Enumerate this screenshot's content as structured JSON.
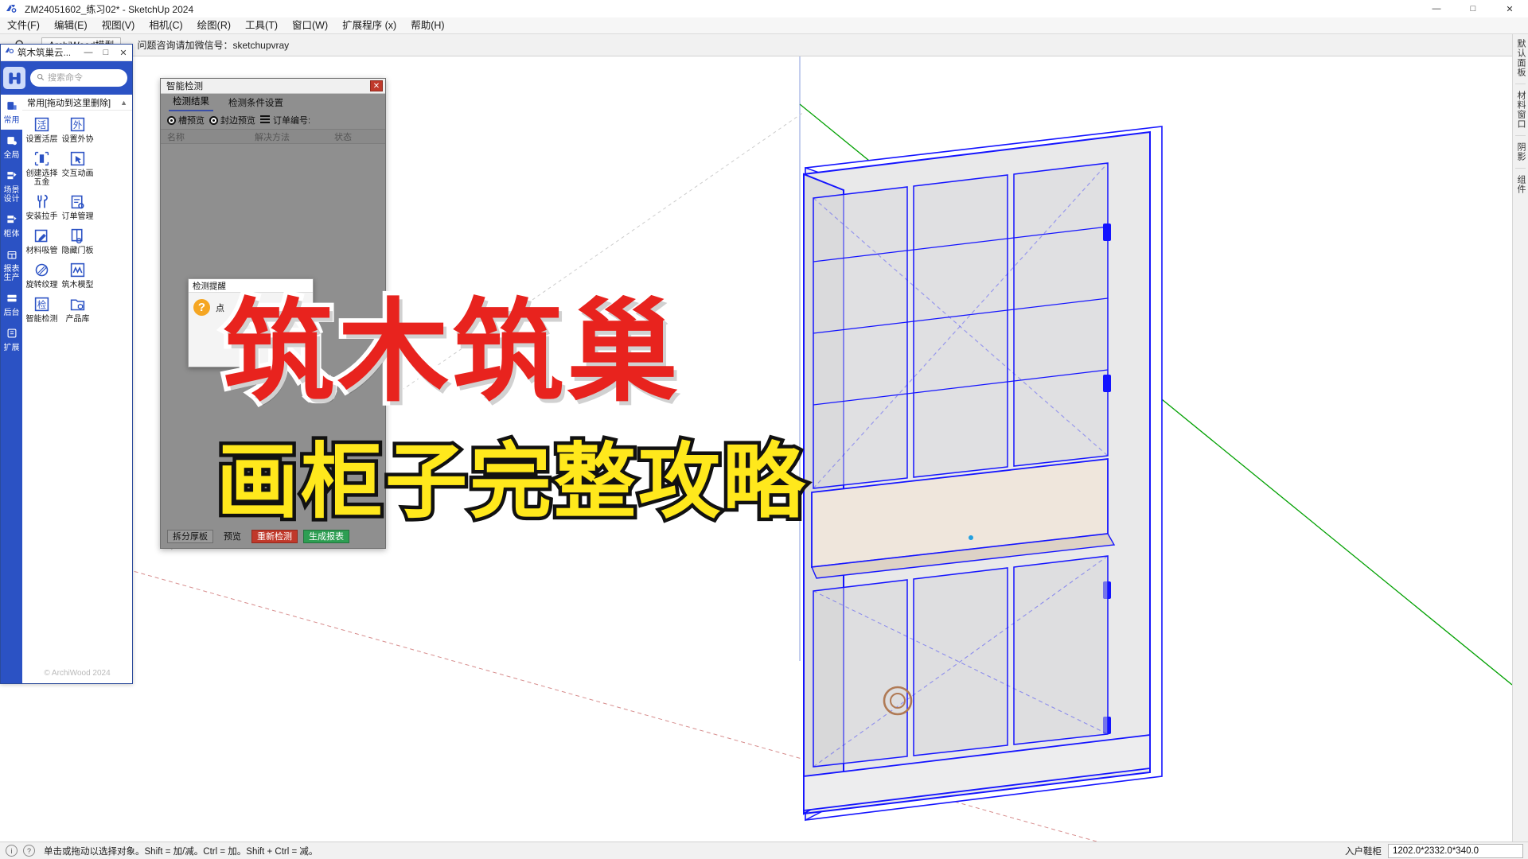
{
  "titlebar": {
    "app_icon": "sketchup-logo-icon",
    "title": "ZM24051602_练习02* - SketchUp 2024",
    "minimize": "—",
    "maximize": "□",
    "close": "✕"
  },
  "menubar": {
    "items": [
      {
        "label": "文件(F)",
        "name": "menu-file"
      },
      {
        "label": "编辑(E)",
        "name": "menu-edit"
      },
      {
        "label": "视图(V)",
        "name": "menu-view"
      },
      {
        "label": "相机(C)",
        "name": "menu-camera"
      },
      {
        "label": "绘图(R)",
        "name": "menu-draw"
      },
      {
        "label": "工具(T)",
        "name": "menu-tools"
      },
      {
        "label": "窗口(W)",
        "name": "menu-window"
      },
      {
        "label": "扩展程序 (x)",
        "name": "menu-extensions"
      },
      {
        "label": "帮助(H)",
        "name": "menu-help"
      }
    ]
  },
  "toolbar": {
    "search_icon": "search-icon",
    "model_tab": "ArchiWood模型",
    "notice": "问题咨询请加微信号：sketchupvray"
  },
  "rightdock": {
    "items": [
      "默认面板",
      "材料窗口",
      "阴影",
      "组件"
    ]
  },
  "plugin": {
    "window_icon": "archiwood-logo-icon",
    "window_title": "筑木筑巢云...",
    "win_minimize": "—",
    "win_maximize": "□",
    "win_close": "✕",
    "logo_icon": "archiwood-brand-icon",
    "search": {
      "placeholder": "搜索命令",
      "value": "",
      "icon": "search-icon"
    },
    "rail": [
      {
        "label": "常用",
        "icon": "common-icon",
        "active": true
      },
      {
        "label": "全局",
        "icon": "global-icon",
        "active": false
      },
      {
        "label": "场景\n设计",
        "icon": "scene-design-icon",
        "active": false
      },
      {
        "label": "柜体",
        "icon": "cabinet-icon",
        "active": false
      },
      {
        "label": "报表\n生产",
        "icon": "report-icon",
        "active": false
      },
      {
        "label": "后台",
        "icon": "backend-icon",
        "active": false
      },
      {
        "label": "扩展",
        "icon": "extension-icon",
        "active": false
      }
    ],
    "group_title": "常用[拖动到这里删除]",
    "group_chevron": "chevron-up-icon",
    "commands": [
      {
        "label": "设置活层",
        "icon": "active-layer-icon"
      },
      {
        "label": "设置外协",
        "icon": "outsource-icon"
      },
      {
        "label": "创建选择五金",
        "icon": "hardware-select-icon"
      },
      {
        "label": "交互动画",
        "icon": "interactive-animation-icon"
      },
      {
        "label": "安装拉手",
        "icon": "install-handle-icon"
      },
      {
        "label": "订单管理",
        "icon": "order-manage-icon"
      },
      {
        "label": "材料吸管",
        "icon": "material-eyedropper-icon"
      },
      {
        "label": "隐藏门板",
        "icon": "hide-door-icon"
      },
      {
        "label": "旋转纹理",
        "icon": "rotate-texture-icon"
      },
      {
        "label": "筑木模型",
        "icon": "archiwood-model-icon"
      },
      {
        "label": "智能检测",
        "icon": "smart-detect-icon"
      },
      {
        "label": "产品库",
        "icon": "product-library-icon"
      }
    ],
    "footer": "© ArchiWood 2024"
  },
  "dialog": {
    "title": "智能检测",
    "close": "✕",
    "tabs": [
      {
        "label": "检测结果",
        "active": true
      },
      {
        "label": "检测条件设置",
        "active": false
      }
    ],
    "options": [
      {
        "label": "槽预览",
        "type": "radio",
        "checked": true
      },
      {
        "label": "封边预览",
        "type": "radio",
        "checked": true
      },
      {
        "label": "订单编号:",
        "type": "menu",
        "checked": false
      }
    ],
    "table_headers": [
      "名称",
      "解决方法",
      "状态"
    ],
    "rows": [],
    "footer_buttons": [
      {
        "label": "拆分厚板",
        "style": "normal"
      },
      {
        "label": "预览",
        "style": "flat"
      },
      {
        "label": "重新检测",
        "style": "red"
      },
      {
        "label": "生成报表",
        "style": "green"
      }
    ]
  },
  "subdialog": {
    "title": "检测提醒",
    "icon": "question-icon",
    "message": "点"
  },
  "overlay": {
    "headline": "筑木筑巢",
    "subline": "画柜子完整攻略",
    "headline_color": "#e8231e",
    "subline_color": "#ffe81c"
  },
  "statusbar": {
    "info_icon": "info-icon",
    "help_icon": "help-icon",
    "hint": "单击或拖动以选择对象。Shift = 加/减。Ctrl = 加。Shift + Ctrl = 减。",
    "measure_label": "入户鞋柜",
    "measure_value": "1202.0*2332.0*340.0"
  },
  "model": {
    "name": "cabinet-3d-model",
    "edge_color": "#1414ff",
    "axis_green": "#00a000",
    "axis_red": "#d46060"
  }
}
